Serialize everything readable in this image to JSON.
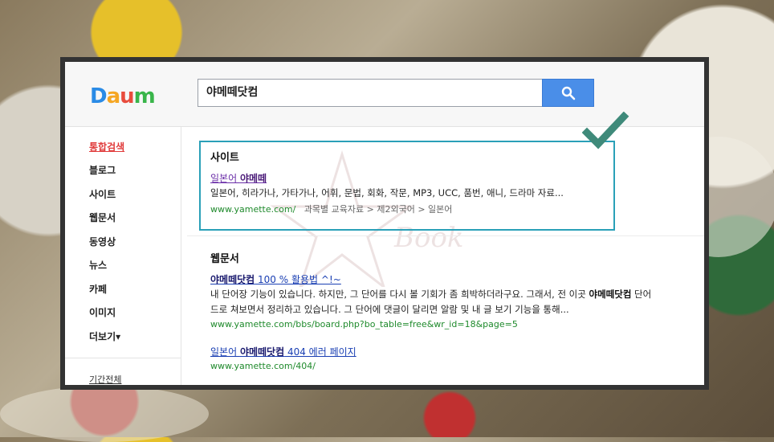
{
  "header": {
    "logo": {
      "p1": "D",
      "p2": "a",
      "p3": "u",
      "p4": "m"
    },
    "search_value": "야메떼닷컴"
  },
  "sidebar": {
    "items": [
      "통합검색",
      "블로그",
      "사이트",
      "웹문서",
      "동영상",
      "뉴스",
      "카페",
      "이미지",
      "더보기"
    ],
    "more_arrow": "▾",
    "period": "기간전체"
  },
  "site_section": {
    "title": "사이트",
    "result": {
      "title_prefix": "일본어 ",
      "title_bold": "야메떼",
      "desc": "일본어, 히라가나, 가타가나, 어휘, 문법, 회화, 작문, MP3, UCC, 품번, 애니, 드라마 자료...",
      "url": "www.yamette.com/",
      "crumb": "과목별 교육자료 > 제2외국어 > 일본어"
    }
  },
  "web_section": {
    "title": "웹문서",
    "results": [
      {
        "title_bold": "야메떼닷컴",
        "title_rest": " 100 % 활용법 ^!~",
        "desc1_a": "내 단어장 기능이 있습니다. 하지만, 그 단어를 다시 볼 기회가 좀 희박하더라구요. 그래서, 전 이곳 ",
        "desc1_bold": "야메떼닷컴",
        "desc1_b": " 단어",
        "desc2": "드로 쳐보면서 정리하고 있습니다. 그 단어에 댓글이 달리면 알람 및 내 글 보기 기능을 통해...",
        "url": "www.yamette.com/bbs/board.php?bo_table=free&wr_id=18&page=5"
      },
      {
        "title_prefix": "일본어 ",
        "title_bold": "야메떼닷컴",
        "title_rest": " 404 에러 페이지",
        "url": "www.yamette.com/404/"
      }
    ]
  },
  "watermark": "Book",
  "colors": {
    "accent": "#4a8ee8",
    "highlight": "#2aa0b8",
    "check": "#3f8a7a",
    "active_nav": "#e03a3a",
    "url": "#1f8a2c"
  }
}
